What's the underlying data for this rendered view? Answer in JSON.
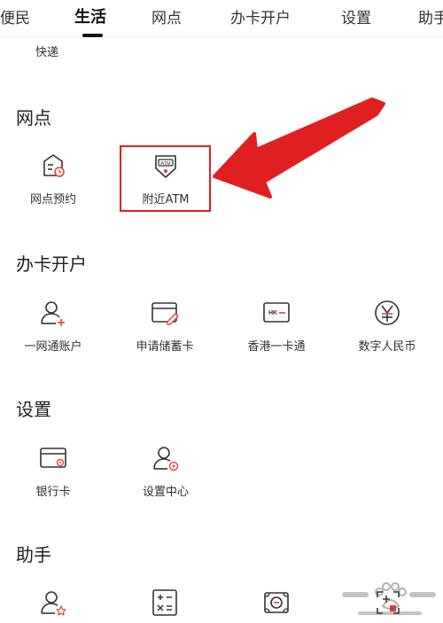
{
  "tabs": [
    {
      "label": "便民"
    },
    {
      "label": "生活"
    },
    {
      "label": "网点"
    },
    {
      "label": "办卡开户"
    },
    {
      "label": "设置"
    },
    {
      "label": "助手"
    }
  ],
  "top_item": "快递",
  "sections": {
    "branch": {
      "title": "网点",
      "items": [
        "网点预约",
        "附近ATM"
      ]
    },
    "card": {
      "title": "办卡开户",
      "items": [
        "一网通账户",
        "申请储蓄卡",
        "香港一卡通",
        "数字人民币"
      ]
    },
    "settings": {
      "title": "设置",
      "items": [
        "银行卡",
        "设置中心"
      ]
    },
    "assistant": {
      "title": "助手"
    }
  },
  "icon_text": {
    "atm": "ATM",
    "hk": "HK"
  },
  "colors": {
    "accent_red": "#e02020",
    "icon_stroke": "#333333",
    "icon_accent": "#e8403a"
  }
}
